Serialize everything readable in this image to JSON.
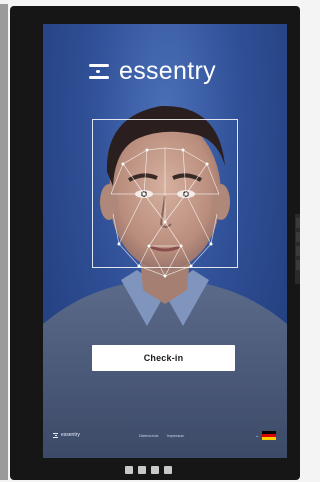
{
  "brand": {
    "name": "essentry"
  },
  "main": {
    "checkin_label": "Check-in"
  },
  "footer": {
    "brand": "essentry",
    "links": [
      "Datenschutz",
      "Impressum"
    ],
    "language_flag": "german-flag-icon"
  },
  "colors": {
    "screen_bg": "#2f4f96",
    "button_bg": "#ffffff",
    "flag": [
      "#000000",
      "#dd0000",
      "#ffce00"
    ]
  }
}
